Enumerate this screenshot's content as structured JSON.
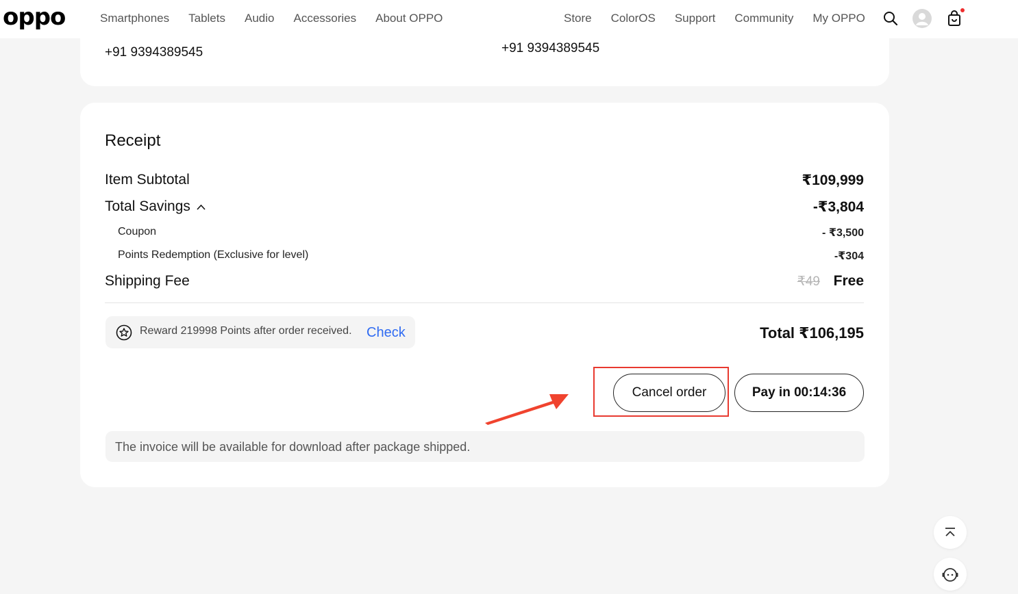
{
  "header": {
    "logo": "oppo",
    "nav_left": [
      "Smartphones",
      "Tablets",
      "Audio",
      "Accessories",
      "About OPPO"
    ],
    "nav_right": [
      "Store",
      "ColorOS",
      "Support",
      "Community",
      "My OPPO"
    ],
    "icons": [
      "search-icon",
      "account-icon",
      "cart-icon"
    ],
    "cart_badge_color": "#ee2e2e"
  },
  "contact": {
    "phone_left": "+91 9394389545",
    "phone_right": "+91 9394389545"
  },
  "receipt": {
    "title": "Receipt",
    "item_subtotal_label": "Item Subtotal",
    "item_subtotal_value": "₹109,999",
    "total_savings_label": "Total Savings",
    "total_savings_value": "-₹3,804",
    "coupon_label": "Coupon",
    "coupon_value": "- ₹3,500",
    "points_label": "Points Redemption (Exclusive for level)",
    "points_value": "-₹304",
    "shipping_label": "Shipping Fee",
    "shipping_original": "₹49",
    "shipping_value": "Free",
    "reward_text": "Reward 219998 Points after order received.",
    "reward_link": "Check",
    "total": "Total ₹106,195",
    "cancel_button": "Cancel order",
    "pay_button": "Pay in 00:14:36",
    "invoice_note": "The invoice will be available for download after package shipped."
  },
  "colors": {
    "accent_link": "#2f6bf2",
    "highlight": "#e8392f",
    "arrow": "#f0432e"
  },
  "floating": [
    "back-to-top-icon",
    "chat-bot-icon"
  ]
}
